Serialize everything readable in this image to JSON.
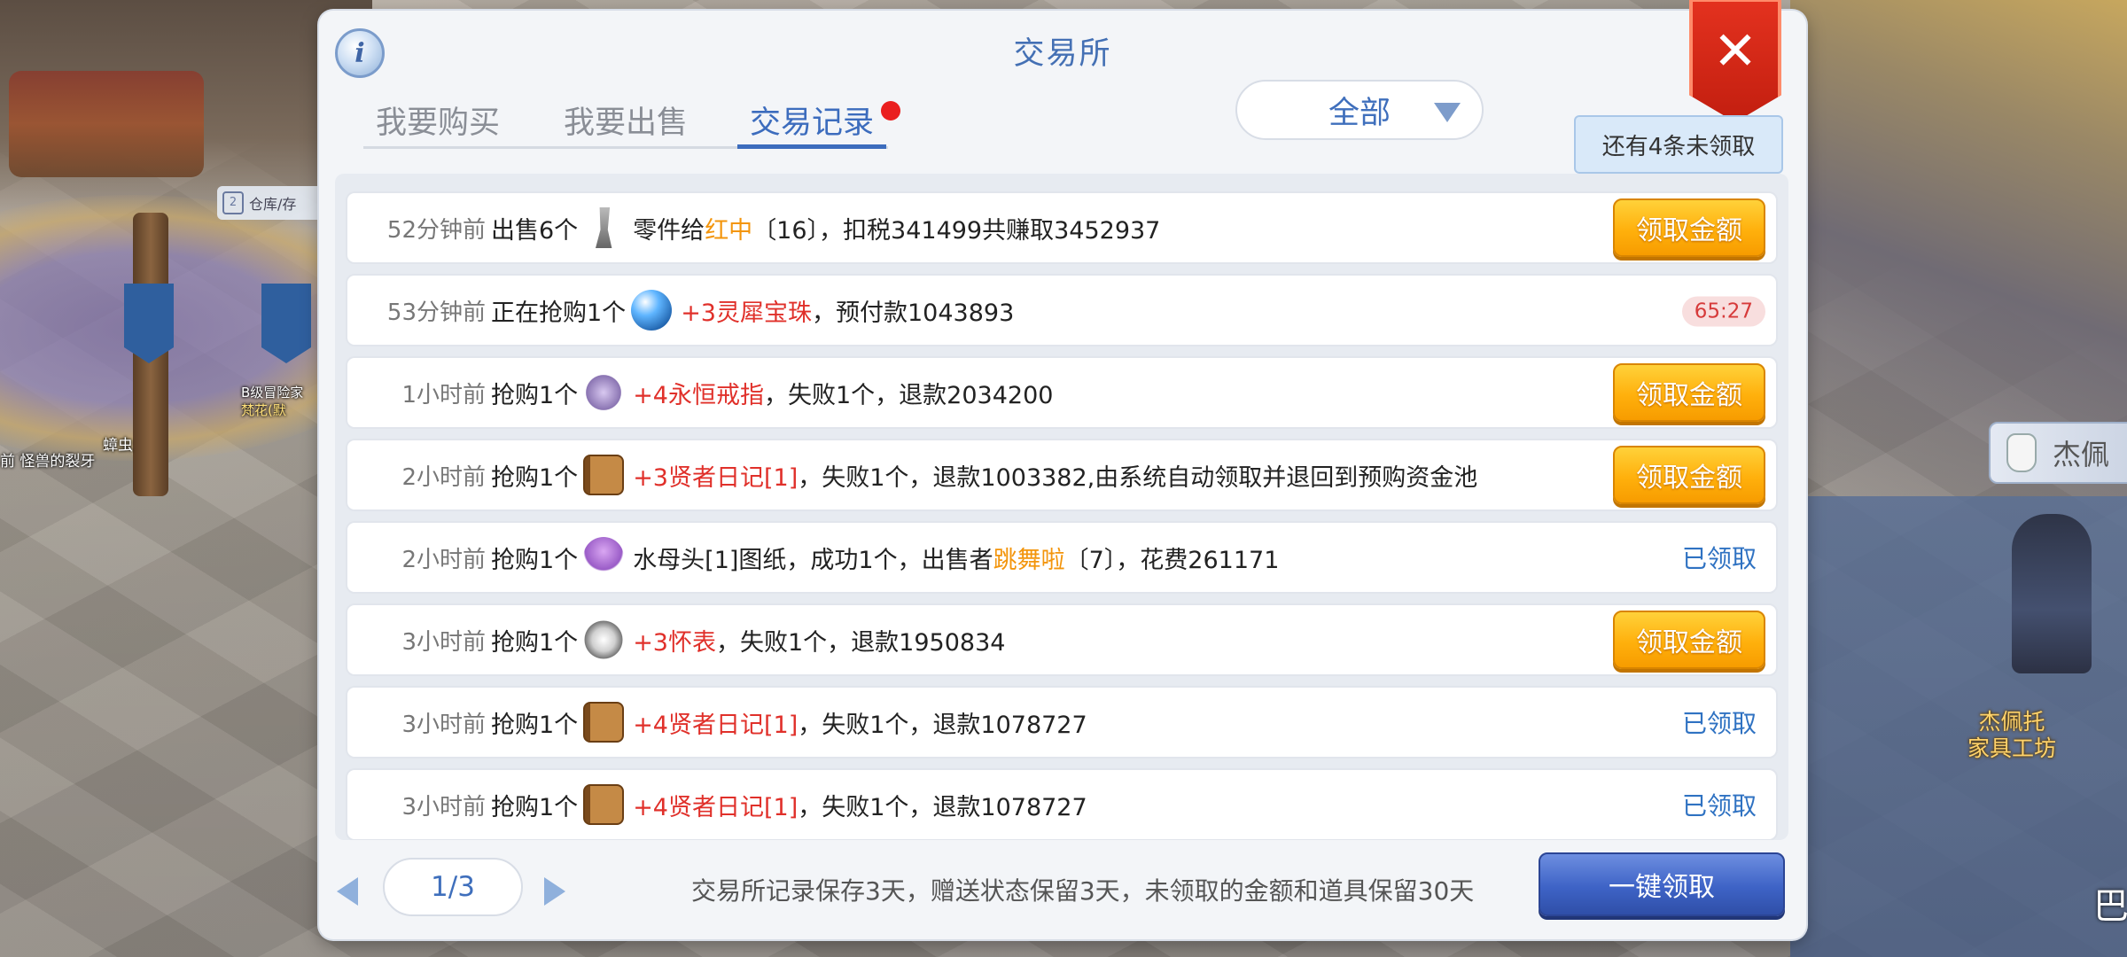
{
  "world": {
    "warehouse_label": "仓库/存",
    "label_left_1": "前 怪兽的裂牙",
    "label_left_2": "蟑虫",
    "label_left_3": "B级冒险家",
    "label_left_4": "梵花(默",
    "npc_name": "杰佩托\n家具工坊",
    "side_npc_text": "杰佩",
    "corner_glyph": "巴"
  },
  "panel": {
    "title": "交易所",
    "close_label": "✕",
    "info_label": "i",
    "tabs": [
      {
        "label": "我要购买",
        "active": false
      },
      {
        "label": "我要出售",
        "active": false
      },
      {
        "label": "交易记录",
        "active": true
      }
    ],
    "filter_value": "全部",
    "unclaimed_tip": "还有4条未领取"
  },
  "records": [
    {
      "time": "52分钟前",
      "action": "出售6个",
      "icon": "wrench-icon",
      "parts": [
        {
          "text": "零件给",
          "style": "normal"
        },
        {
          "text": "红中",
          "style": "orange"
        },
        {
          "text": "〔16〕，扣税341499共赚取3452937",
          "style": "normal"
        }
      ],
      "status": "claim",
      "status_label": "领取金额"
    },
    {
      "time": "53分钟前",
      "action": "正在抢购1个",
      "icon": "orb-icon",
      "parts": [
        {
          "text": "+3灵犀宝珠",
          "style": "red"
        },
        {
          "text": "，预付款1043893",
          "style": "normal"
        }
      ],
      "status": "timer",
      "status_label": "65:27"
    },
    {
      "time": "1小时前",
      "action": "抢购1个",
      "icon": "ring-icon",
      "parts": [
        {
          "text": "+4永恒戒指",
          "style": "red"
        },
        {
          "text": "，失败1个，退款2034200",
          "style": "normal"
        }
      ],
      "status": "claim",
      "status_label": "领取金额"
    },
    {
      "time": "2小时前",
      "action": "抢购1个",
      "icon": "book-icon",
      "parts": [
        {
          "text": "+3贤者日记[1]",
          "style": "red"
        },
        {
          "text": "，失败1个，退款1003382,由系统自动领取并退回到预购资金池",
          "style": "normal"
        }
      ],
      "status": "claim",
      "status_label": "领取金额"
    },
    {
      "time": "2小时前",
      "action": "抢购1个",
      "icon": "jellyfish-icon",
      "parts": [
        {
          "text": "水母头[1]图纸，成功1个，出售者",
          "style": "normal"
        },
        {
          "text": "跳舞啦",
          "style": "orange"
        },
        {
          "text": "〔7〕，花费261171",
          "style": "normal"
        }
      ],
      "status": "claimed",
      "status_label": "已领取"
    },
    {
      "time": "3小时前",
      "action": "抢购1个",
      "icon": "pocket-watch-icon",
      "parts": [
        {
          "text": "+3怀表",
          "style": "red"
        },
        {
          "text": "，失败1个，退款1950834",
          "style": "normal"
        }
      ],
      "status": "claim",
      "status_label": "领取金额"
    },
    {
      "time": "3小时前",
      "action": "抢购1个",
      "icon": "book-icon",
      "parts": [
        {
          "text": "+4贤者日记[1]",
          "style": "red"
        },
        {
          "text": "，失败1个，退款1078727",
          "style": "normal"
        }
      ],
      "status": "claimed",
      "status_label": "已领取"
    },
    {
      "time": "3小时前",
      "action": "抢购1个",
      "icon": "book-icon",
      "parts": [
        {
          "text": "+4贤者日记[1]",
          "style": "red"
        },
        {
          "text": "，失败1个，退款1078727",
          "style": "normal"
        }
      ],
      "status": "claimed",
      "status_label": "已领取"
    }
  ],
  "footer": {
    "page": "1/3",
    "note": "交易所记录保存3天，赠送状态保留3天，未领取的金额和道具保留30天",
    "claim_all_label": "一键领取"
  },
  "colors": {
    "accent_blue": "#3c6cbd",
    "claim_orange": "#ffb00c",
    "item_red": "#e0302a",
    "name_orange": "#f3950c",
    "close_red": "#e4321f"
  }
}
